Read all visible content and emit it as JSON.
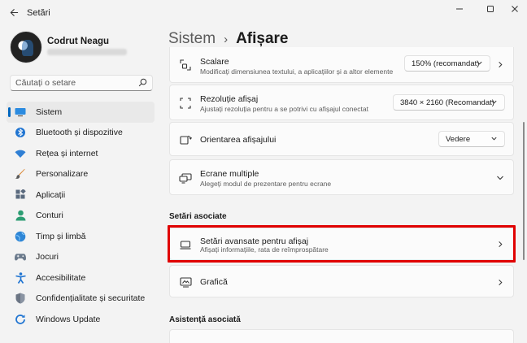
{
  "app": {
    "title": "Setări"
  },
  "user": {
    "name": "Codrut Neagu"
  },
  "search": {
    "placeholder": "Căutați o setare"
  },
  "nav": [
    {
      "label": "Sistem",
      "icon": "monitor-icon",
      "active": true
    },
    {
      "label": "Bluetooth și dispozitive",
      "icon": "bluetooth-icon"
    },
    {
      "label": "Rețea și internet",
      "icon": "wifi-icon"
    },
    {
      "label": "Personalizare",
      "icon": "brush-icon"
    },
    {
      "label": "Aplicații",
      "icon": "apps-icon"
    },
    {
      "label": "Conturi",
      "icon": "person-icon"
    },
    {
      "label": "Timp și limbă",
      "icon": "globe-icon"
    },
    {
      "label": "Jocuri",
      "icon": "gamepad-icon"
    },
    {
      "label": "Accesibilitate",
      "icon": "accessibility-icon"
    },
    {
      "label": "Confidențialitate și securitate",
      "icon": "shield-icon"
    },
    {
      "label": "Windows Update",
      "icon": "update-icon"
    }
  ],
  "breadcrumb": {
    "parent": "Sistem",
    "current": "Afișare"
  },
  "cards": {
    "scale": {
      "title": "Scalare",
      "subtitle": "Modificați dimensiunea textului, a aplicațiilor și a altor elemente",
      "value": "150% (recomandat)"
    },
    "resolution": {
      "title": "Rezoluție afișaj",
      "subtitle": "Ajustați rezoluția pentru a se  potrivi cu afișajul conectat",
      "value": "3840 × 2160 (Recomandat)"
    },
    "orientation": {
      "title": "Orientarea afișajului",
      "value": "Vedere"
    },
    "multiple": {
      "title": "Ecrane multiple",
      "subtitle": "Alegeți modul de prezentare pentru ecrane"
    },
    "advanced": {
      "title": "Setări avansate pentru afișaj",
      "subtitle": "Afișați informațiile, rata de reîmprospătare"
    },
    "graphics": {
      "title": "Grafică"
    }
  },
  "sections": {
    "related": "Setări asociate",
    "support": "Asistență asociată"
  },
  "colors": {
    "accent": "#0067c0",
    "highlight": "#e00000"
  }
}
